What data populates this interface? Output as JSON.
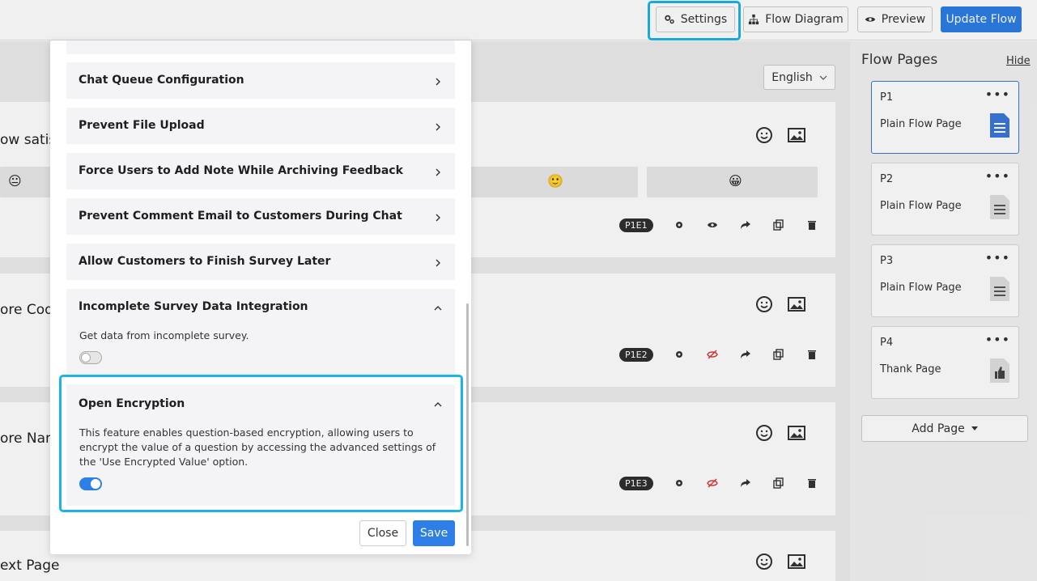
{
  "topbar": {
    "settings_label": "Settings",
    "flow_diagram_label": "Flow Diagram",
    "preview_label": "Preview",
    "update_flow_label": "Update Flow"
  },
  "language": {
    "selected": "English"
  },
  "cards": [
    {
      "title": "ow satisf",
      "tag": "P1E1"
    },
    {
      "title": "ore Cod",
      "tag": "P1E2"
    },
    {
      "title": "ore Nam",
      "tag": "P1E3"
    },
    {
      "title": "ext Page"
    }
  ],
  "sidebar": {
    "title": "Flow Pages",
    "hide_label": "Hide",
    "pages": [
      {
        "id": "P1",
        "name": "Plain Flow Page",
        "doc_color": "#3a78d8"
      },
      {
        "id": "P2",
        "name": "Plain Flow Page",
        "doc_color": "#e0e0e0"
      },
      {
        "id": "P3",
        "name": "Plain Flow Page",
        "doc_color": "#e0e0e0"
      },
      {
        "id": "P4",
        "name": "Thank Page",
        "doc_color": "#e0e0e0"
      }
    ],
    "add_page_label": "Add Page"
  },
  "modal": {
    "sections": [
      {
        "title": "Chat Queue Configuration"
      },
      {
        "title": "Prevent File Upload"
      },
      {
        "title": "Force Users to Add Note While Archiving Feedback"
      },
      {
        "title": "Prevent Comment Email to Customers During Chat"
      },
      {
        "title": "Allow Customers to Finish Survey Later"
      },
      {
        "title": "Incomplete Survey Data Integration",
        "description": "Get data from incomplete survey.",
        "enabled": false
      },
      {
        "title": "Open Encryption",
        "description": "This feature enables question-based encryption, allowing users to encrypt the value of a question by accessing the advanced settings of the 'Use Encrypted Value' option.",
        "enabled": true
      }
    ],
    "close_label": "Close",
    "save_label": "Save"
  },
  "colors": {
    "primary": "#2d7ee6",
    "highlight": "#19b5e6"
  }
}
